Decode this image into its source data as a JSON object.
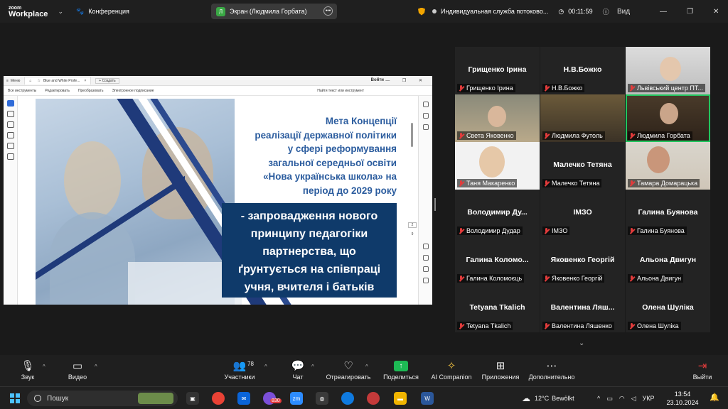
{
  "app": {
    "brand_line1": "zoom",
    "brand_line2": "Workplace",
    "meeting_label": "Конференция"
  },
  "screen_share": {
    "avatar_letter": "Л",
    "label": "Экран (Людмила Горбата)"
  },
  "top_right": {
    "stream_label": "Индивидуальная служба потоково...",
    "timer": "00:11:59",
    "view_label": "Вид"
  },
  "editor": {
    "menu_label": "Меню",
    "tab_title": "Blue and White Profe...",
    "new_tab": "+ Создать",
    "login": "Войти",
    "menu_items": [
      "Все инструменты",
      "Редактировать",
      "Преобразовать",
      "Электронное подписание"
    ],
    "search": "Найти текст или инструмент",
    "page_current": "2",
    "page_total": "9"
  },
  "slide": {
    "title_lines": [
      "Мета Концепції",
      "реалізації державної політики",
      "у сфері реформування",
      "загальної середньої освіти",
      "«Нова українська школа» на",
      "період до 2029 року"
    ],
    "box_lines": [
      "- запровадження нового",
      "принципу педагогіки",
      "партнерства, що",
      "ґрунтується на співпраці",
      "учня, вчителя і батьків"
    ]
  },
  "participants": [
    {
      "name": "Грищенко Ірина",
      "label": "Грищенко Ірина",
      "video": false
    },
    {
      "name": "Н.В.Божко",
      "label": "Н.В.Божко",
      "video": false
    },
    {
      "name": "",
      "label": "Львівський центр ПТ...",
      "video": true
    },
    {
      "name": "",
      "label": "Света Яковенко",
      "video": true
    },
    {
      "name": "",
      "label": "Людмила Футоль",
      "video": true
    },
    {
      "name": "",
      "label": "Людмила Горбата",
      "video": true,
      "active": true
    },
    {
      "name": "",
      "label": "Таня Макаренко",
      "video": true
    },
    {
      "name": "Малечко Тетяна",
      "label": "Малечко Тетяна",
      "video": false
    },
    {
      "name": "",
      "label": "Тамара Домарацька",
      "video": true
    },
    {
      "name": "Володимир Ду...",
      "label": "Володимир Дудар",
      "video": false
    },
    {
      "name": "ІМЗО",
      "label": "ІМЗО",
      "video": false
    },
    {
      "name": "Галина Буянова",
      "label": "Галина Буянова",
      "video": false
    },
    {
      "name": "Галина Коломо...",
      "label": "Галина Коломоєць",
      "video": false
    },
    {
      "name": "Яковенко Георгій",
      "label": "Яковенко Георгій",
      "video": false
    },
    {
      "name": "Альона Двигун",
      "label": "Альона Двигун",
      "video": false
    },
    {
      "name": "Tetyana Tkalich",
      "label": "Tetyana Tkalich",
      "video": false
    },
    {
      "name": "Валентина Ляш...",
      "label": "Валентина Ляшенко",
      "video": false
    },
    {
      "name": "Олена Шуліка",
      "label": "Олена Шуліка",
      "video": false
    }
  ],
  "toolbar": {
    "audio": "Звук",
    "video": "Видео",
    "participants": "Участники",
    "participants_count": "78",
    "chat": "Чат",
    "react": "Отреагировать",
    "share": "Поделиться",
    "companion": "AI Companion",
    "apps": "Приложения",
    "more": "Дополнительно",
    "leave": "Выйти"
  },
  "taskbar": {
    "search_placeholder": "Пошук",
    "badge_count": "830",
    "weather_temp": "12°C",
    "weather_text": "Bewölkt",
    "lang": "УКР",
    "time": "13:54",
    "date": "23.10.2024"
  }
}
